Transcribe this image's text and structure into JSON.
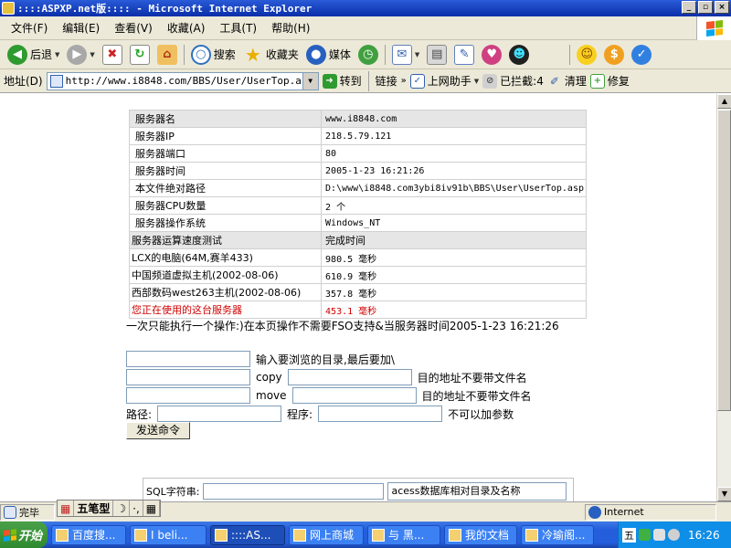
{
  "window": {
    "title": "::::ASPXP.net版:::: - Microsoft Internet Explorer"
  },
  "menu": [
    "文件(F)",
    "编辑(E)",
    "查看(V)",
    "收藏(A)",
    "工具(T)",
    "帮助(H)"
  ],
  "toolbar": {
    "back": "后退",
    "search": "搜索",
    "favorites": "收藏夹",
    "media": "媒体"
  },
  "address": {
    "label": "地址(D)",
    "url": "http://www.i8848.com/BBS/User/UserTop.asp",
    "go": "转到",
    "links": "链接",
    "helper": "上网助手",
    "blocked": "已拦截:4",
    "clean": "清理",
    "repair": "修复"
  },
  "server_table": {
    "rows": [
      {
        "key": "服务器名",
        "value": "www.i8848.com"
      },
      {
        "key": "服务器IP",
        "value": "218.5.79.121"
      },
      {
        "key": "服务器端口",
        "value": "80"
      },
      {
        "key": "服务器时间",
        "value": "2005-1-23 16:21:26"
      },
      {
        "key": "本文件绝对路径",
        "value": "D:\\www\\i8848.com3ybi8iv91b\\BBS\\User\\UserTop.asp"
      },
      {
        "key": "服务器CPU数量",
        "value": "2 个"
      },
      {
        "key": "服务器操作系统",
        "value": "Windows_NT"
      }
    ],
    "speed_header": {
      "key": "服务器运算速度测试",
      "value": "完成时间"
    },
    "speed_rows": [
      {
        "key": "LCX的电脑(64M,赛羊433)",
        "value": "980.5 毫秒"
      },
      {
        "key": "中国频道虚拟主机(2002-08-06)",
        "value": "610.9 毫秒"
      },
      {
        "key": "西部数码west263主机(2002-08-06)",
        "value": "357.8 毫秒"
      },
      {
        "key": "您正在使用的这台服务器",
        "value": "453.1 毫秒"
      }
    ]
  },
  "note": "一次只能执行一个操作:)在本页操作不需要FSO支持&当服务器时间2005-1-23 16:21:26",
  "form": {
    "browse_hint": "输入要浏览的目录,最后要加\\",
    "copy_label": "copy",
    "move_label": "move",
    "dest_hint": "目的地址不要带文件名",
    "path_label": "路径:",
    "program_label": "程序:",
    "param_hint": "不可以加参数",
    "send_button": "发送命令"
  },
  "sql": {
    "label": "SQL字符串:",
    "db_value": "acess数据库相对目录及名称"
  },
  "status": {
    "done": "完毕",
    "ime": "五笔型",
    "zone": "Internet"
  },
  "taskbar": {
    "start": "开始",
    "tasks": [
      "百度搜...",
      "I beli...",
      "::::AS...",
      "网上商城",
      "与 黑...",
      "我的文档",
      "冷瑜阁..."
    ],
    "clock": "16:26",
    "tray_label": "五"
  }
}
